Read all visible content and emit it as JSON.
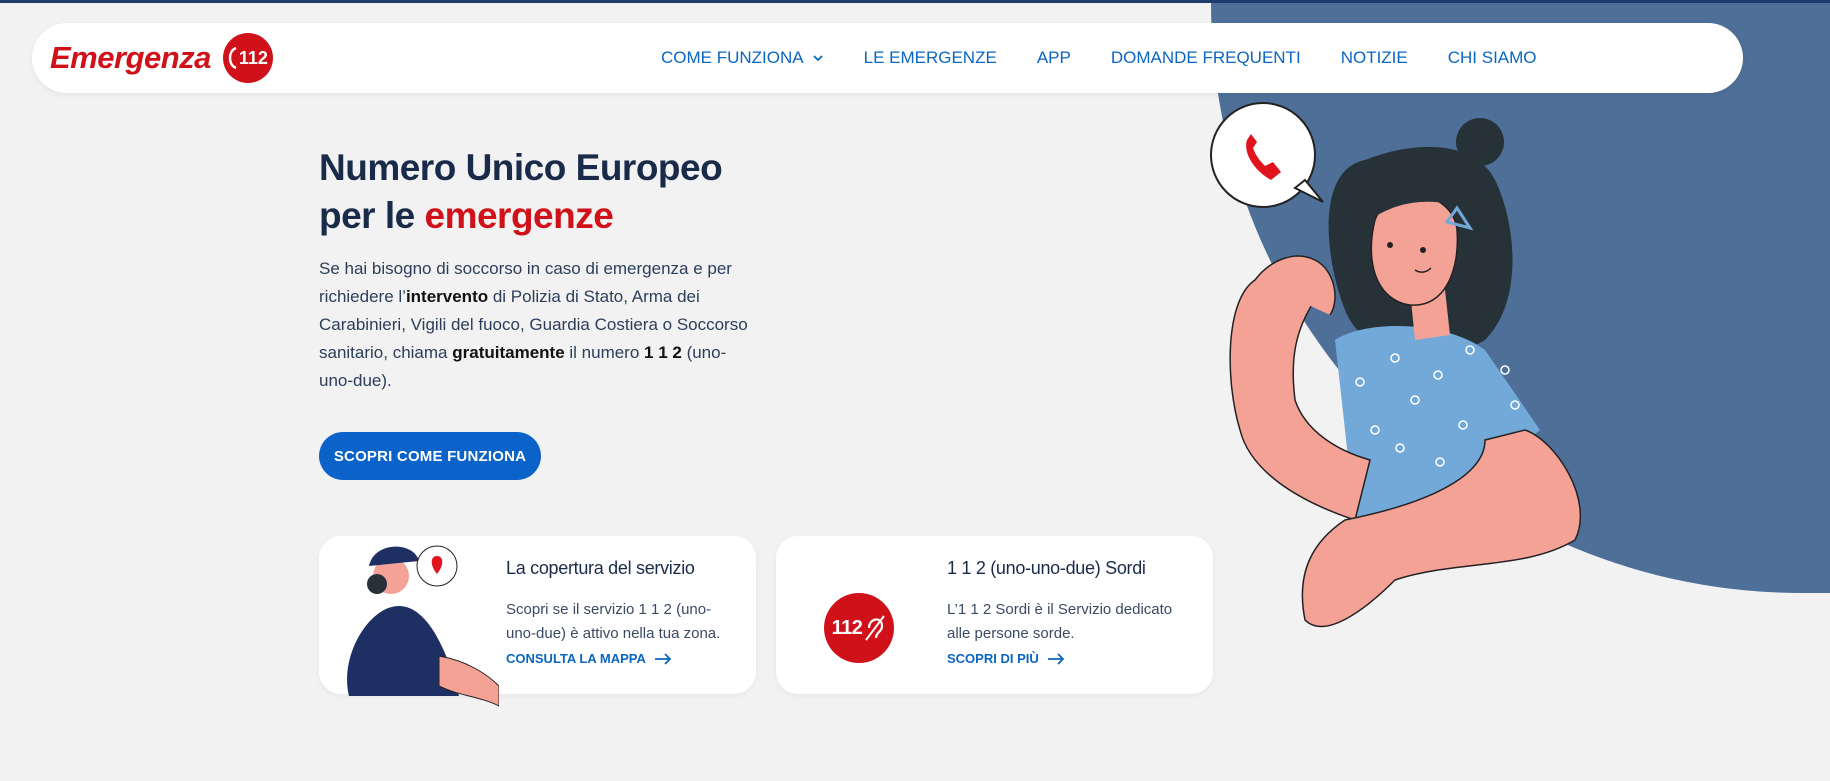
{
  "header": {
    "logo_text": "Emergenza",
    "logo_badge": "112",
    "nav": [
      {
        "label": "COME FUNZIONA",
        "has_dropdown": true
      },
      {
        "label": "LE EMERGENZE"
      },
      {
        "label": "APP"
      },
      {
        "label": "DOMANDE FREQUENTI"
      },
      {
        "label": "NOTIZIE"
      },
      {
        "label": "CHI SIAMO"
      }
    ]
  },
  "hero": {
    "title_line1": "Numero Unico Europeo",
    "title_line2_prefix": "per le ",
    "title_line2_highlight": "emergenze",
    "text_1": "Se hai bisogno di soccorso in caso di emergenza e per richiedere l’",
    "text_bold_1": "intervento",
    "text_2": " di Polizia di Stato, Arma dei Carabinieri, Vigili del fuoco, Guardia Costiera o Soccorso sanitario, chiama ",
    "text_bold_2": "gratuitamente",
    "text_3": " il numero ",
    "text_bold_3": "1 1 2",
    "text_4": " (uno-uno-due).",
    "cta_label": "SCOPRI COME FUNZIONA"
  },
  "cards": [
    {
      "title": "La copertura del servizio",
      "desc": "Scopri se il servizio 1 1 2 (uno-uno-due) è attivo nella tua zona.",
      "link": "CONSULTA LA MAPPA",
      "icon": "officer-illustration"
    },
    {
      "title": "1 1 2 (uno-uno-due) Sordi",
      "desc": "L’1 1 2 Sordi è il Servizio dedicato alle persone sorde.",
      "link": "SCOPRI DI PIÙ",
      "icon": "deaf-112-icon",
      "badge": "112"
    }
  ],
  "colors": {
    "brand_red": "#d0111a",
    "link_blue": "#0a66c2",
    "cta_blue": "#0b63c9",
    "hero_blue_bg": "#4e7098",
    "page_bg": "#f2f2f2"
  }
}
